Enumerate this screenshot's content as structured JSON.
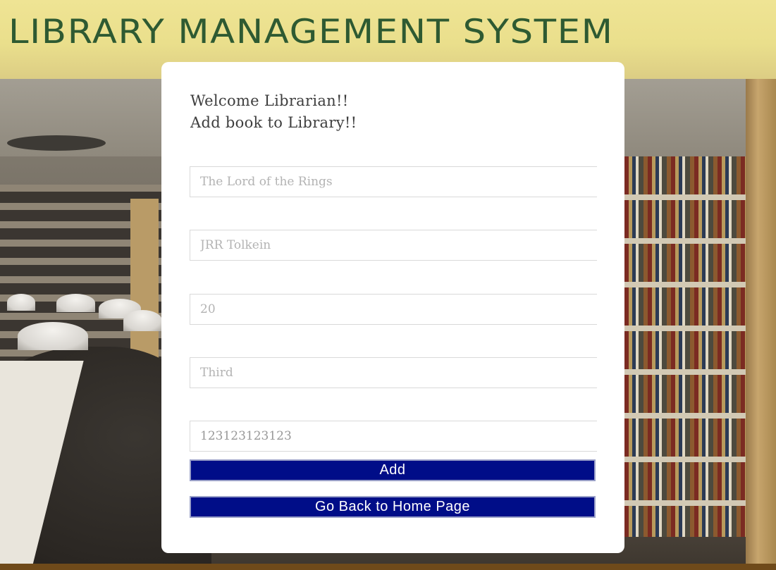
{
  "header": {
    "title": "LIBRARY MANAGEMENT SYSTEM"
  },
  "form": {
    "welcome_line1": "Welcome Librarian!!",
    "welcome_line2": "Add book to Library!!",
    "fields": [
      {
        "name": "book-title",
        "placeholder": "The Lord of the Rings",
        "value": ""
      },
      {
        "name": "author",
        "placeholder": "JRR Tolkein",
        "value": ""
      },
      {
        "name": "copies",
        "placeholder": "20",
        "value": ""
      },
      {
        "name": "edition",
        "placeholder": "Third",
        "value": ""
      },
      {
        "name": "isbn",
        "placeholder": "",
        "value": "123123123123"
      }
    ],
    "add_label": "Add",
    "home_label": "Go Back to Home Page"
  },
  "colors": {
    "banner": "#eadf8c",
    "title_text": "#2e5a32",
    "button_bg": "#000d88",
    "button_text": "#ffffff",
    "card_bg": "#ffffff"
  }
}
